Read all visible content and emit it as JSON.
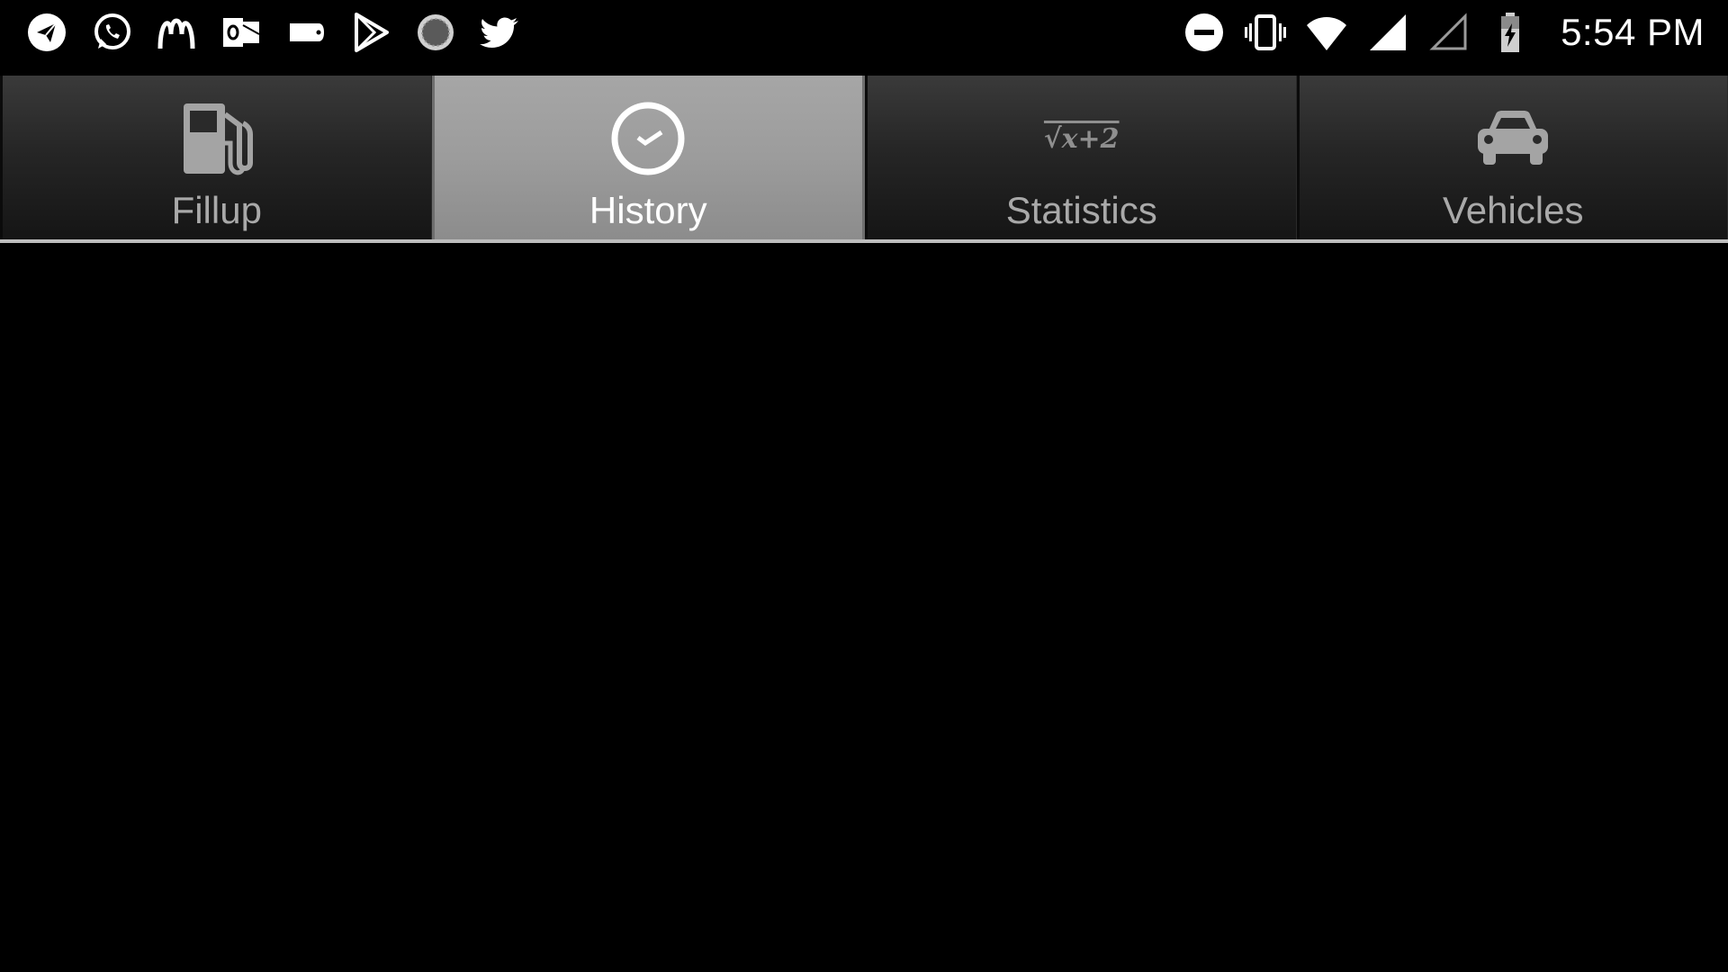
{
  "status_bar": {
    "notification_icons": [
      "telegram-icon",
      "whatsapp-icon",
      "mcdonalds-icon",
      "outlook-icon",
      "tag-icon",
      "play-store-icon",
      "loading-circle-icon",
      "twitter-icon"
    ],
    "system_icons": [
      "do-not-disturb-icon",
      "vibrate-icon",
      "wifi-icon",
      "cell-signal-icon",
      "cell-signal-empty-icon",
      "battery-charging-icon"
    ],
    "time": "5:54 PM"
  },
  "tabs": [
    {
      "label": "Fillup",
      "icon": "fuel-pump-icon",
      "selected": false
    },
    {
      "label": "History",
      "icon": "clock-icon",
      "selected": true
    },
    {
      "label": "Statistics",
      "icon": "sqrt-formula-icon",
      "icon_text": "√x+2",
      "selected": false
    },
    {
      "label": "Vehicles",
      "icon": "car-icon",
      "selected": false
    }
  ],
  "colors": {
    "background": "#000000",
    "tab_selected": "#9c9c9c",
    "tab_unselected": "#262626",
    "tab_label": "#a9a9a9",
    "tab_label_selected": "#ffffff"
  }
}
